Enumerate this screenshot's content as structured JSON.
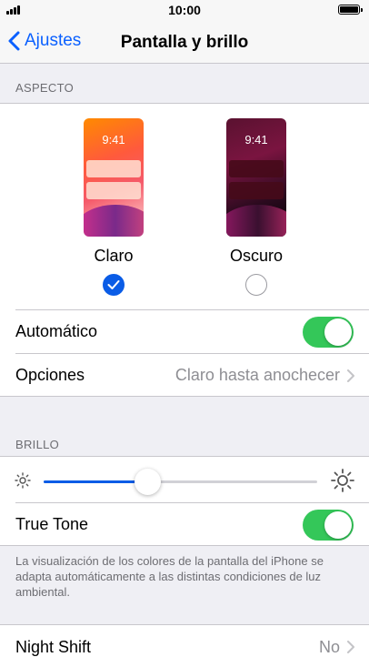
{
  "status": {
    "time": "10:00"
  },
  "nav": {
    "back_label": "Ajustes",
    "title": "Pantalla y brillo"
  },
  "appearance": {
    "header": "ASPECTO",
    "light": {
      "label": "Claro",
      "clock": "9:41",
      "selected": true
    },
    "dark": {
      "label": "Oscuro",
      "clock": "9:41",
      "selected": false
    },
    "automatic": {
      "label": "Automático",
      "on": true
    },
    "options": {
      "label": "Opciones",
      "value": "Claro hasta anochecer"
    }
  },
  "brightness": {
    "header": "BRILLO",
    "level": 0.38,
    "true_tone": {
      "label": "True Tone",
      "on": true
    },
    "footnote": "La visualización de los colores de la pantalla del iPhone se adapta automáticamente a las distintas condiciones de luz ambiental."
  },
  "night_shift": {
    "label": "Night Shift",
    "value": "No"
  },
  "colors": {
    "accent": "#0a5ce6",
    "toggle_on": "#34c759"
  }
}
